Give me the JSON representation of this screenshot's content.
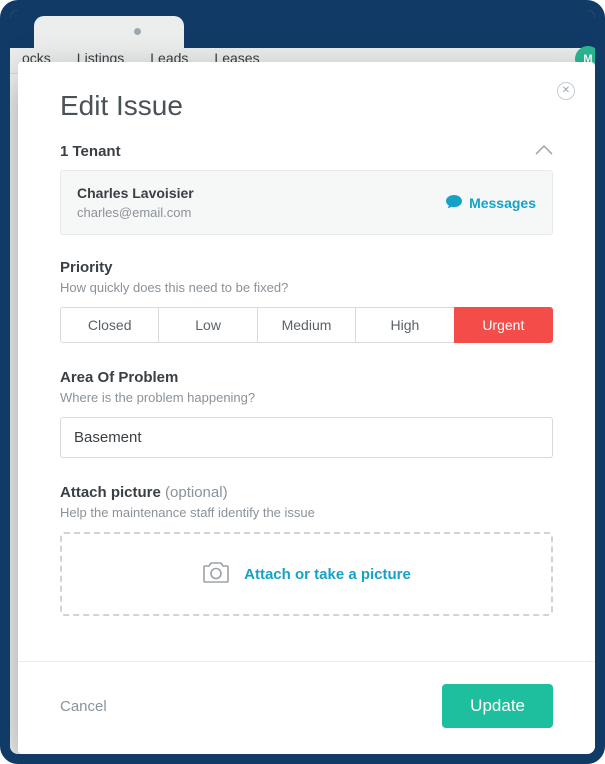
{
  "nav": {
    "items": [
      "ocks",
      "Listings",
      "Leads",
      "Leases"
    ],
    "avatar": "M"
  },
  "modal": {
    "title": "Edit Issue",
    "tenant_header": "1 Tenant",
    "tenant": {
      "name": "Charles Lavoisier",
      "email": "charles@email.com",
      "messages_label": "Messages"
    },
    "priority": {
      "title": "Priority",
      "subtitle": "How quickly does this need to be fixed?",
      "options": [
        "Closed",
        "Low",
        "Medium",
        "High",
        "Urgent"
      ],
      "selected": "Urgent"
    },
    "area": {
      "title": "Area Of Problem",
      "subtitle": "Where is the problem happening?",
      "value": "Basement"
    },
    "attach": {
      "title": "Attach picture",
      "optional": "(optional)",
      "subtitle": "Help the maintenance staff identify the issue",
      "cta": "Attach or take a picture"
    },
    "footer": {
      "cancel": "Cancel",
      "update": "Update"
    }
  }
}
